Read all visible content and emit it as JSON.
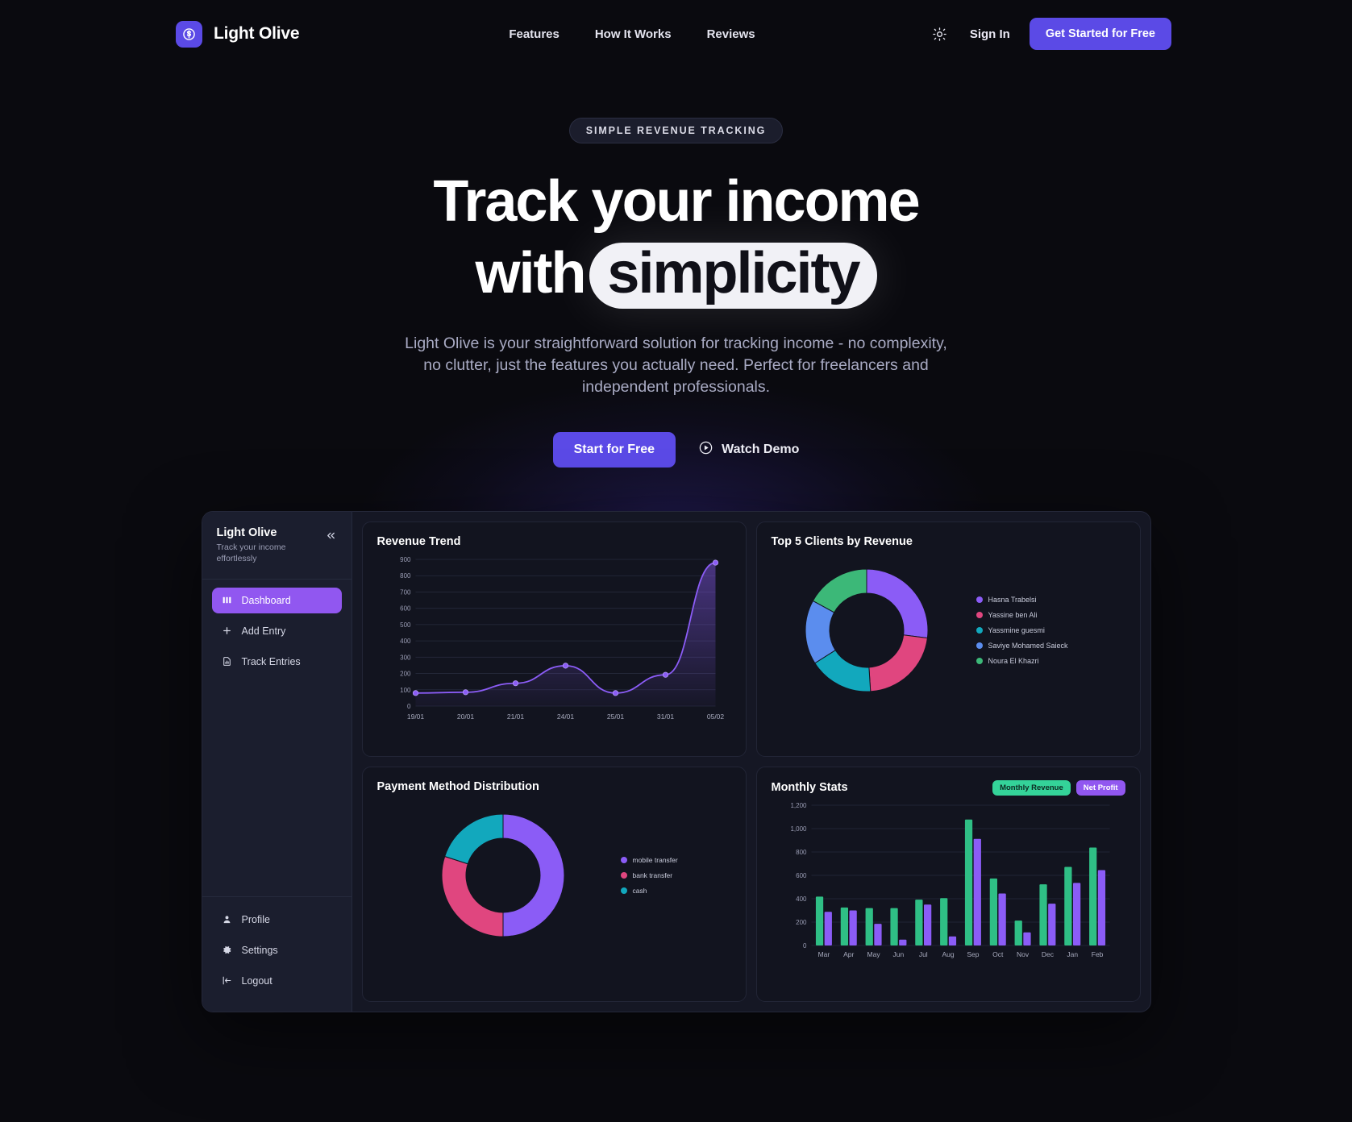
{
  "header": {
    "brand": "Light Olive",
    "brand_icon": "dollar-circle-icon",
    "nav": [
      "Features",
      "How It Works",
      "Reviews"
    ],
    "theme_icon": "sun-icon",
    "signin": "Sign In",
    "cta": "Get Started for Free"
  },
  "hero": {
    "badge": "SIMPLE REVENUE TRACKING",
    "title_line1": "Track your income",
    "title_line2_prefix": "with",
    "title_highlight": "simplicity",
    "subtitle": "Light Olive is your straightforward solution for tracking income - no complexity, no clutter, just the features you actually need. Perfect for freelancers and independent professionals.",
    "primary_cta": "Start for Free",
    "secondary_cta": "Watch Demo",
    "secondary_cta_icon": "play-circle-icon"
  },
  "dashboard": {
    "sidebar": {
      "title": "Light Olive",
      "subtitle": "Track your income effortlessly",
      "collapse_icon": "chevrons-left-icon",
      "items": [
        {
          "label": "Dashboard",
          "icon": "bar-chart-icon",
          "active": true
        },
        {
          "label": "Add Entry",
          "icon": "plus-icon",
          "active": false
        },
        {
          "label": "Track Entries",
          "icon": "file-chart-icon",
          "active": false
        }
      ],
      "footer_items": [
        {
          "label": "Profile",
          "icon": "user-icon"
        },
        {
          "label": "Settings",
          "icon": "gear-icon"
        },
        {
          "label": "Logout",
          "icon": "logout-icon"
        }
      ]
    },
    "cards": {
      "revenue_trend_title": "Revenue Trend",
      "top_clients_title": "Top 5 Clients by Revenue",
      "payment_title": "Payment Method Distribution",
      "monthly_title": "Monthly Stats",
      "monthly_badges": [
        "Monthly Revenue",
        "Net Profit"
      ]
    }
  },
  "chart_data": [
    {
      "type": "line",
      "title": "Revenue Trend",
      "x": [
        "19/01",
        "20/01",
        "21/01",
        "24/01",
        "25/01",
        "31/01",
        "05/02"
      ],
      "values": [
        80,
        85,
        140,
        248,
        80,
        192,
        880
      ],
      "ylim": [
        0,
        900
      ],
      "yticks": [
        0,
        100,
        200,
        300,
        400,
        500,
        600,
        700,
        800,
        900
      ],
      "xlabel": "",
      "ylabel": "",
      "grid": true,
      "color": "#8b5cf6",
      "area_fill": true
    },
    {
      "type": "pie",
      "title": "Top 5 Clients by Revenue",
      "labels": [
        "Hasna Trabelsi",
        "Yassine ben Ali",
        "Yassmine guesmi",
        "Saviye Mohamed Saieck",
        "Noura El Khazri"
      ],
      "values": [
        27,
        22,
        17,
        17,
        17
      ],
      "colors": [
        "#8b5cf6",
        "#e0467f",
        "#12a8bd",
        "#5b8dee",
        "#3cb878"
      ],
      "legend_position": "right",
      "donut": true
    },
    {
      "type": "pie",
      "title": "Payment Method Distribution",
      "labels": [
        "mobile transfer",
        "bank transfer",
        "cash"
      ],
      "values": [
        50,
        30,
        20
      ],
      "colors": [
        "#8b5cf6",
        "#e0467f",
        "#12a8bd"
      ],
      "legend_position": "right",
      "donut": true
    },
    {
      "type": "bar",
      "title": "Monthly Stats",
      "categories": [
        "Mar",
        "Apr",
        "May",
        "Jun",
        "Jul",
        "Aug",
        "Sep",
        "Oct",
        "Nov",
        "Dec",
        "Jan",
        "Feb"
      ],
      "series": [
        {
          "name": "Monthly Revenue",
          "color": "#2fbf85",
          "values": [
            418,
            325,
            320,
            320,
            392,
            405,
            1078,
            573,
            213,
            523,
            672,
            838
          ]
        },
        {
          "name": "Net Profit",
          "color": "#8b5cf6",
          "values": [
            288,
            300,
            185,
            50,
            350,
            78,
            912,
            445,
            112,
            358,
            535,
            645
          ]
        }
      ],
      "ylim": [
        0,
        1200
      ],
      "yticks": [
        "0",
        "200",
        "400",
        "600",
        "800",
        "1,000",
        "1,200"
      ],
      "grid": true
    }
  ]
}
